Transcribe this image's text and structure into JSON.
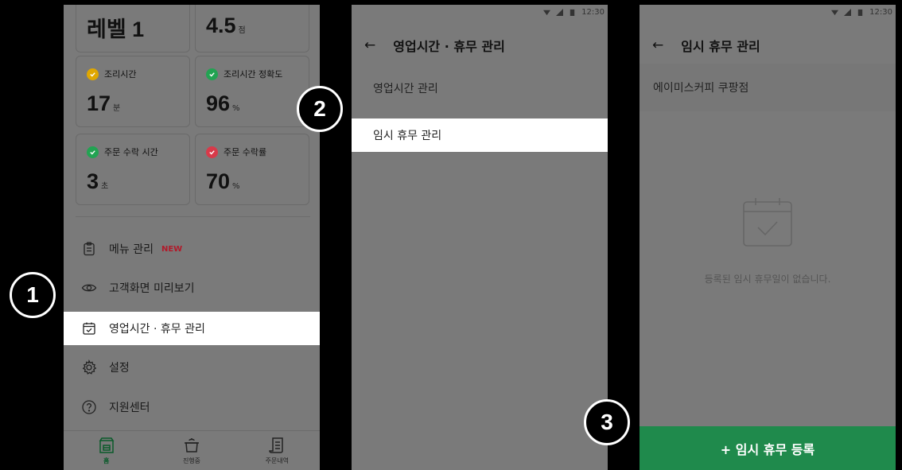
{
  "screen1": {
    "cards": [
      {
        "value": "레벨 1",
        "unit": ""
      },
      {
        "value": "4.5",
        "unit": "점"
      },
      {
        "label": "조리시간",
        "value": "17",
        "unit": "분",
        "status": "warning"
      },
      {
        "label": "조리시간 정확도",
        "value": "96",
        "unit": "%",
        "status": "good"
      },
      {
        "label": "주문 수락 시간",
        "value": "3",
        "unit": "초",
        "status": "good"
      },
      {
        "label": "주문 수락률",
        "value": "70",
        "unit": "%",
        "status": "bad"
      }
    ],
    "menu": [
      {
        "label": "메뉴 관리",
        "tag": "NEW",
        "icon": "clipboard-icon"
      },
      {
        "label": "고객화면 미리보기",
        "icon": "eye-icon"
      },
      {
        "label": "영업시간 · 휴무 관리",
        "icon": "calendar-check-icon",
        "active": true
      },
      {
        "label": "설정",
        "icon": "gear-icon"
      },
      {
        "label": "지원센터",
        "icon": "help-icon"
      }
    ],
    "nav": [
      {
        "label": "홈",
        "icon": "home-store-icon",
        "active": true
      },
      {
        "label": "진행중",
        "icon": "pot-icon"
      },
      {
        "label": "주문내역",
        "icon": "receipt-icon"
      }
    ]
  },
  "screen2": {
    "time": "12:30",
    "title": "영업시간 · 휴무 관리",
    "items": [
      {
        "label": "영업시간 관리"
      },
      {
        "label": "임시 휴무 관리",
        "active": true
      }
    ]
  },
  "screen3": {
    "time": "12:30",
    "title": "임시 휴무 관리",
    "store": "에이미스커피 쿠팡점",
    "empty_text": "등록된 임시 휴무일이 없습니다.",
    "cta": "+ 임시 휴무 등록"
  },
  "badges": [
    "1",
    "2",
    "3"
  ],
  "colors": {
    "warning": "#e0a700",
    "good": "#22a352",
    "bad": "#d83a4a",
    "cta": "#1f8a4c",
    "new_tag": "#b11a2a"
  }
}
